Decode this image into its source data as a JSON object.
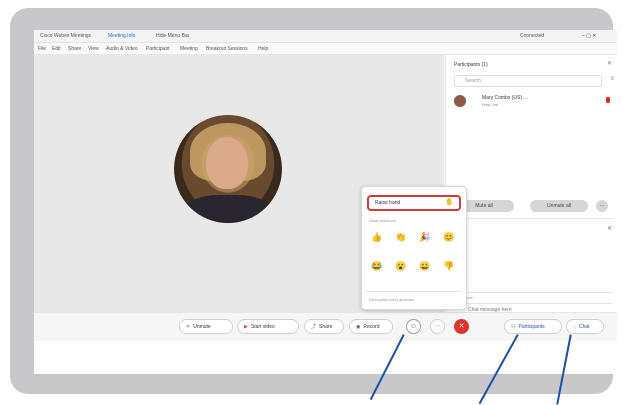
{
  "titlebar": {
    "app_title": "Cisco Webex Meetings",
    "tab_meeting_info": "Meeting Info",
    "tab_hide_menu": "Hide Menu Bar",
    "connection": "Connected"
  },
  "menu": [
    "File",
    "Edit",
    "Share",
    "View",
    "Audio & Video",
    "Participant",
    "Meeting",
    "Breakout Sessions",
    "Help"
  ],
  "participants_panel": {
    "title": "Participants (1)",
    "search_placeholder": "Search",
    "participant_name": "Mary Combs (US) ...",
    "participant_role": "Host, me",
    "mute_all": "Mute all",
    "unmute_all": "Unmute all"
  },
  "chat_panel": {
    "to_label": "Everyone",
    "message_placeholder": "Chat message here"
  },
  "reaction_popup": {
    "raise_hand": "Raise hand",
    "reactions_label": "Send reactions",
    "emojis": [
      "👍",
      "👏",
      "🎉",
      "😊",
      "😂",
      "😮",
      "😀",
      "👎"
    ],
    "gestures_label": "Recognize hand gestures"
  },
  "toolbar": {
    "unmute": "Unmute",
    "start_video": "Start video",
    "share": "Share",
    "record": "Record",
    "participants": "Participants",
    "chat": "Chat"
  },
  "colors": {
    "frame": "#c8c8ca",
    "stage": "#e8e8e8",
    "accent_blue": "#1d4fa6",
    "end_call": "#e0322f",
    "highlight_red": "#d43a3a"
  }
}
